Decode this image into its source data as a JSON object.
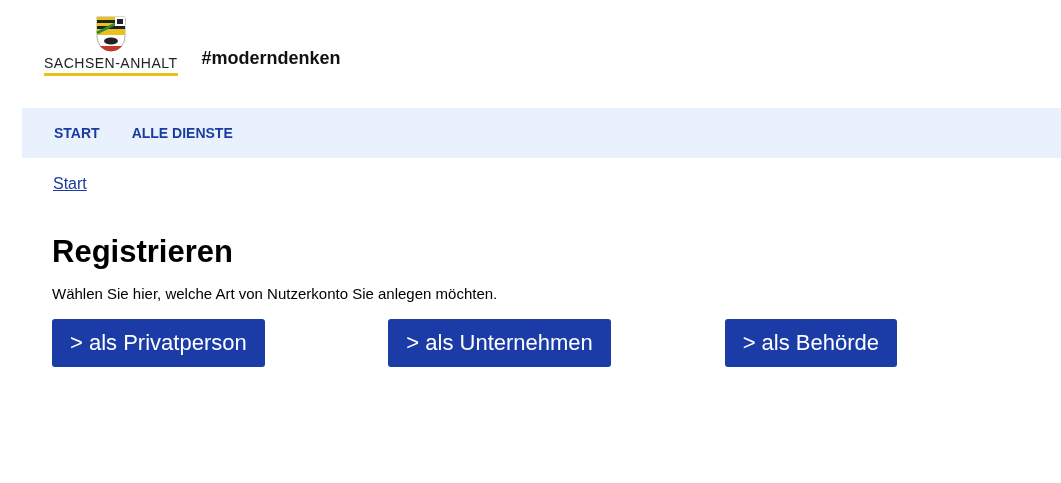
{
  "header": {
    "state_name": "SACHSEN-ANHALT",
    "slogan": "#moderndenken"
  },
  "nav": [
    {
      "label": "START"
    },
    {
      "label": "ALLE DIENSTE"
    }
  ],
  "breadcrumb": [
    "Start"
  ],
  "heading": "Registrieren",
  "intro": "Wählen Sie hier, welche Art von Nutzerkonto Sie anlegen möchten.",
  "buttons": [
    "> als Privatperson",
    "> als Unternehmen",
    "> als Behörde"
  ]
}
